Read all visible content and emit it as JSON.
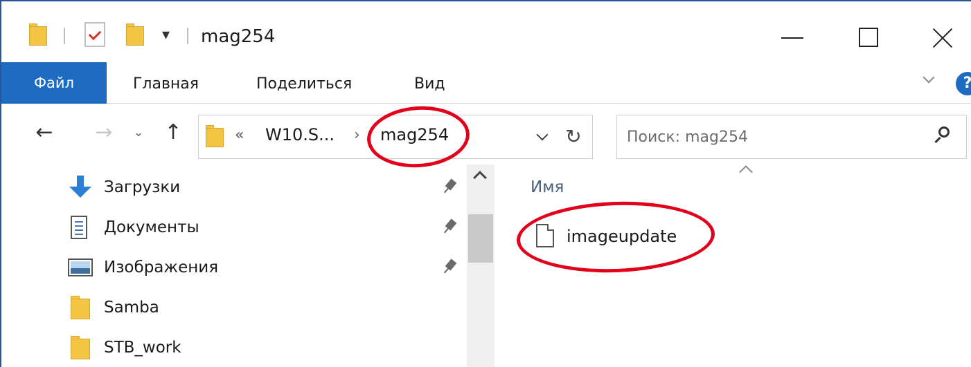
{
  "window": {
    "title": "mag254",
    "controls": {
      "minimize": "minimize",
      "maximize": "maximize",
      "close": "close"
    }
  },
  "ribbon": {
    "tabs": [
      {
        "label": "Файл",
        "active": true
      },
      {
        "label": "Главная"
      },
      {
        "label": "Поделиться"
      },
      {
        "label": "Вид"
      }
    ],
    "help_label": "?",
    "accent": "#1e6bc2"
  },
  "address": {
    "overflow": "«",
    "crumbs": [
      "W10.S...",
      "mag254"
    ],
    "separator": "›",
    "refresh": "↻"
  },
  "search": {
    "placeholder": "Поиск: mag254"
  },
  "navigation": {
    "back": "←",
    "forward": "→",
    "recent": "⌄",
    "up": "↑"
  },
  "nav_pane": {
    "items": [
      {
        "label": "Загрузки",
        "icon": "download-icon",
        "pinned": true
      },
      {
        "label": "Документы",
        "icon": "document-icon",
        "pinned": true
      },
      {
        "label": "Изображения",
        "icon": "pictures-icon",
        "pinned": true
      },
      {
        "label": "Samba",
        "icon": "folder-icon",
        "pinned": false
      },
      {
        "label": "STB_work",
        "icon": "folder-icon",
        "pinned": false
      }
    ]
  },
  "content": {
    "column_name": "Имя",
    "files": [
      {
        "name": "imageupdate",
        "icon": "file-icon"
      }
    ]
  },
  "annotations": {
    "color": "#e3001b"
  }
}
